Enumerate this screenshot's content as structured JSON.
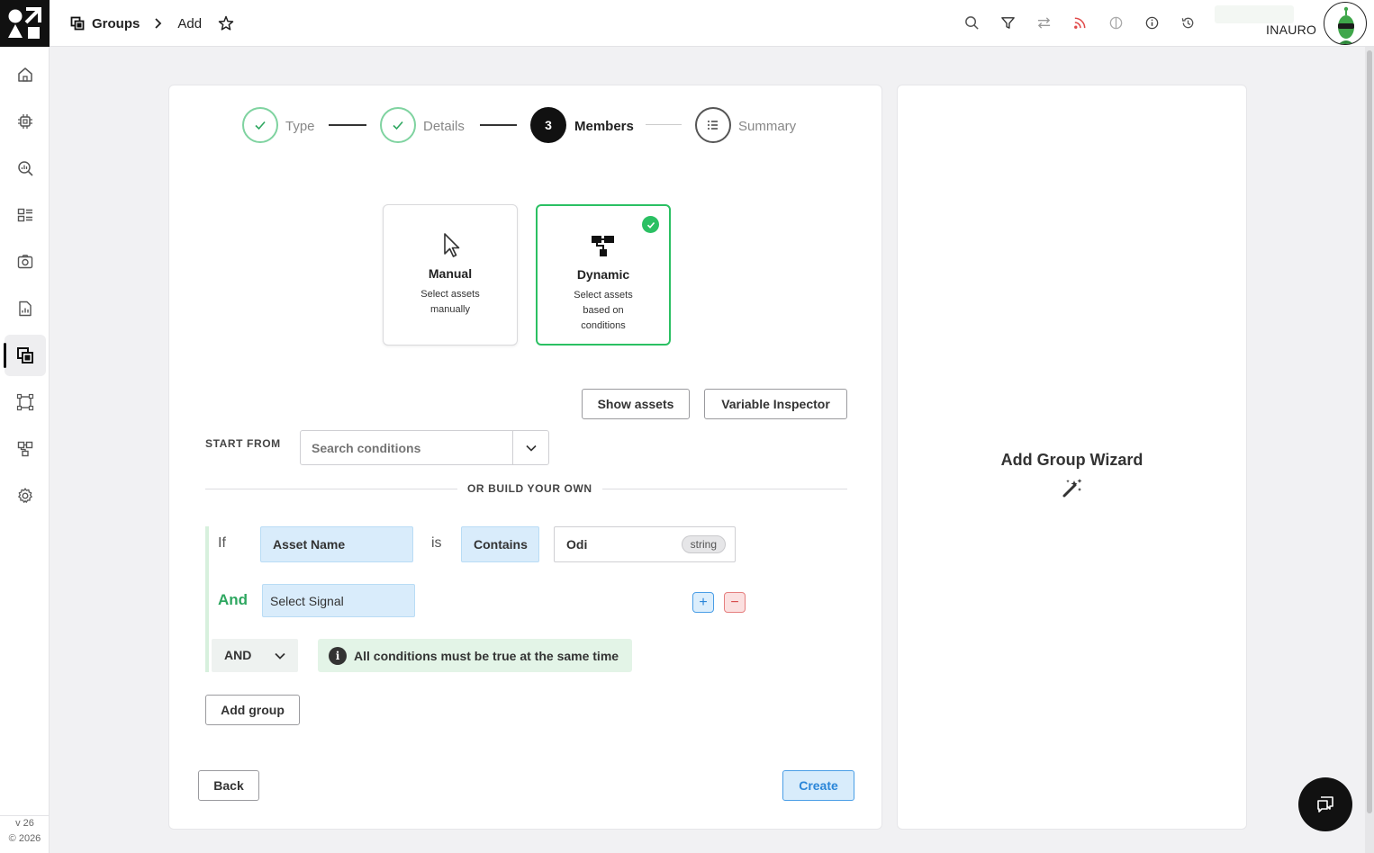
{
  "breadcrumb": {
    "section": "Groups",
    "current": "Add"
  },
  "user": {
    "name": "INAURO"
  },
  "sidebar": {
    "items": [
      {
        "icon": "home-icon"
      },
      {
        "icon": "chip-icon"
      },
      {
        "icon": "search-chart-icon"
      },
      {
        "icon": "dashboard-icon"
      },
      {
        "icon": "camera-icon"
      },
      {
        "icon": "report-icon"
      },
      {
        "icon": "groups-icon",
        "active": true
      },
      {
        "icon": "device-frame-icon"
      },
      {
        "icon": "hierarchy-icon"
      },
      {
        "icon": "gear-icon"
      }
    ],
    "version": "v 26",
    "copyright": "© 2026"
  },
  "stepper": {
    "steps": [
      {
        "label": "Type",
        "state": "done"
      },
      {
        "label": "Details",
        "state": "done"
      },
      {
        "label": "Members",
        "state": "current",
        "number": "3"
      },
      {
        "label": "Summary",
        "state": "todo"
      }
    ]
  },
  "modes": {
    "manual": {
      "title": "Manual",
      "desc": "Select assets manually"
    },
    "dynamic": {
      "title": "Dynamic",
      "desc": "Select assets based on conditions",
      "selected": true
    }
  },
  "actions": {
    "show_assets": "Show assets",
    "variable_inspector": "Variable Inspector"
  },
  "start_from": {
    "label": "START FROM",
    "placeholder": "Search conditions"
  },
  "or_build": "OR BUILD YOUR OWN",
  "condition": {
    "if_label": "If",
    "field": "Asset Name",
    "is_label": "is",
    "operator": "Contains",
    "value": "Odi",
    "value_type": "string",
    "and_label": "And",
    "signal_placeholder": "Select Signal",
    "add_symbol": "+",
    "remove_symbol": "−"
  },
  "logic": {
    "value": "AND",
    "info": "All conditions must be true at the same time",
    "info_symbol": "i"
  },
  "add_group": "Add group",
  "back": "Back",
  "create": "Create",
  "wizard": {
    "title": "Add Group Wizard"
  },
  "colors": {
    "accent_green": "#2bc063",
    "accent_blue": "#2b86d8",
    "danger": "#d84b4b"
  }
}
